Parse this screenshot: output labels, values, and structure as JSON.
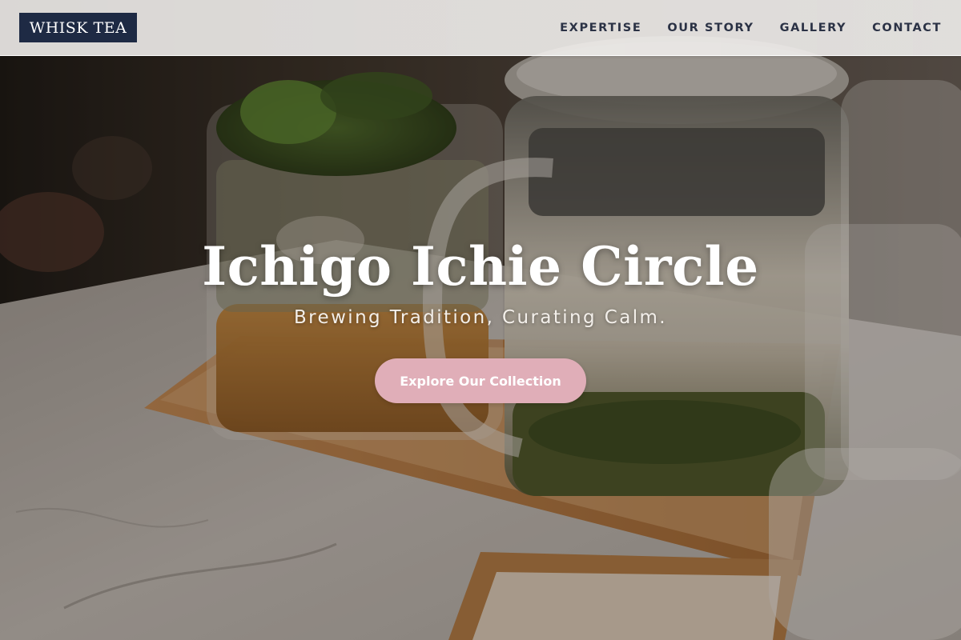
{
  "brand": {
    "logo_text": "WHISK TEA"
  },
  "nav": {
    "items": [
      {
        "label": "EXPERTISE"
      },
      {
        "label": "OUR STORY"
      },
      {
        "label": "GALLERY"
      },
      {
        "label": "CONTACT"
      }
    ]
  },
  "hero": {
    "title": "Ichigo Ichie Circle",
    "subtitle": "Brewing Tradition, Curating Calm.",
    "cta_label": "Explore Our Collection",
    "background_image": "tea-photo"
  },
  "colors": {
    "logo_background": "#1e2a44",
    "nav_text": "#2b3245",
    "cta_background": "#e0aeb8",
    "title_text": "#ffffff"
  }
}
